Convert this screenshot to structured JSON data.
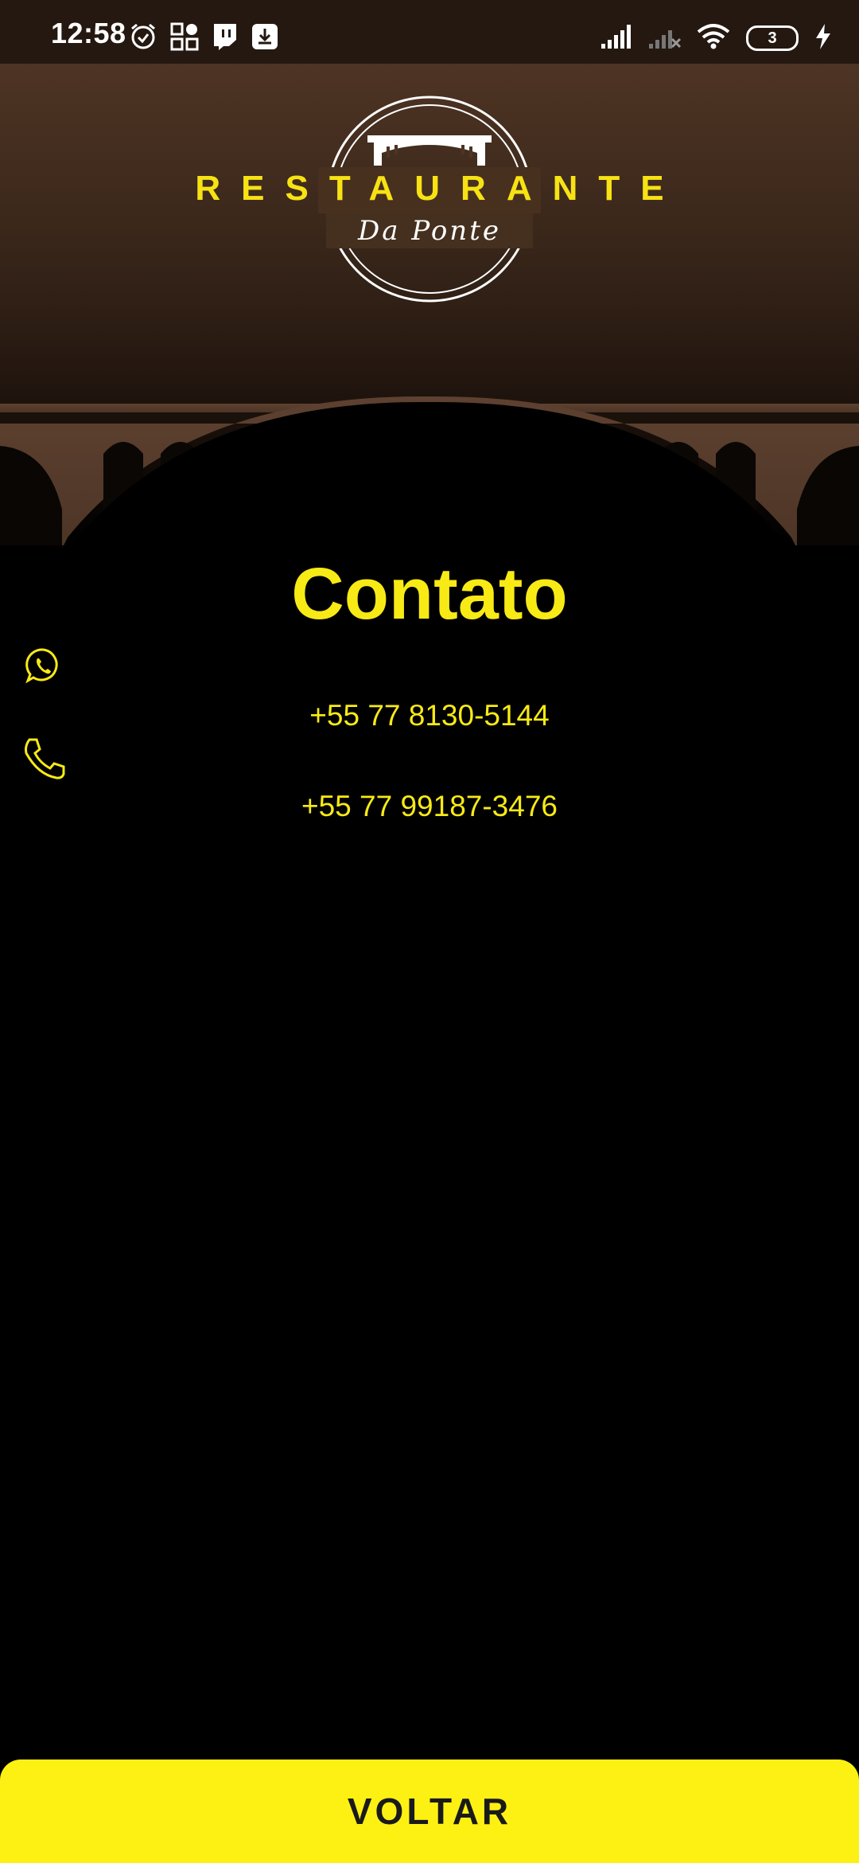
{
  "status_bar": {
    "time": "12:58",
    "battery_level": "3",
    "icons_left": [
      "alarm-icon",
      "grid-apps-icon",
      "twitch-icon",
      "download-icon"
    ],
    "icons_right": [
      "signal-icon",
      "signal-no-service-icon",
      "wifi-icon",
      "battery-icon",
      "charging-icon"
    ]
  },
  "header": {
    "logo_word": "RESTAURANTE",
    "logo_sub": "Da Ponte"
  },
  "content": {
    "title": "Contato",
    "contacts": [
      {
        "icon": "whatsapp-icon",
        "phone": "+55 77 8130-5144"
      },
      {
        "icon": "phone-icon",
        "phone": "+55 77 99187-3476"
      }
    ]
  },
  "footer": {
    "back_label": "VOLTAR"
  },
  "colors": {
    "accent": "#f8ea15",
    "button": "#fcf112",
    "bridge": "#5a3e2b",
    "background": "#000000"
  }
}
